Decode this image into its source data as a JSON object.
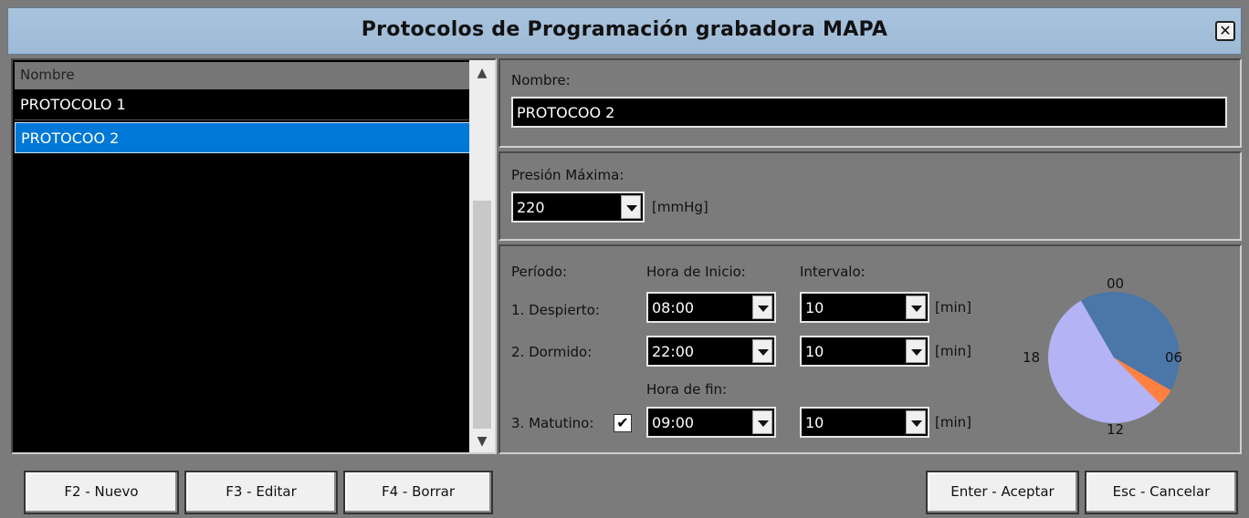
{
  "window": {
    "title": "Protocolos de Programación grabadora MAPA",
    "close_label": "✕"
  },
  "list": {
    "header": "Nombre",
    "rows": [
      "PROTOCOLO 1",
      "PROTOCOO 2"
    ],
    "selected_index": 1
  },
  "nombre": {
    "label": "Nombre:",
    "value": "PROTOCOO 2"
  },
  "presion": {
    "label": "Presión Máxima:",
    "value": "220",
    "unit": "[mmHg]"
  },
  "periodo": {
    "col_period": "Período:",
    "col_start": "Hora de Inicio:",
    "col_interval": "Intervalo:",
    "col_end": "Hora de fin:",
    "unit": "[min]",
    "rows": [
      {
        "label": "1. Despierto:",
        "time": "08:00",
        "interval": "10"
      },
      {
        "label": "2. Dormido:",
        "time": "22:00",
        "interval": "10"
      },
      {
        "label": "3. Matutino:",
        "time": "09:00",
        "interval": "10",
        "checked": true
      }
    ]
  },
  "clock": {
    "labels": {
      "top": "00",
      "right": "06",
      "bottom": "12",
      "left": "18"
    },
    "segments": [
      {
        "name": "Despierto",
        "from_hour": 8,
        "to_hour": 22,
        "color": "#b3b3f5"
      },
      {
        "name": "Dormido",
        "from_hour": 22,
        "to_hour": 8,
        "color": "#4a76a8"
      },
      {
        "name": "Matutino",
        "from_hour": 8,
        "to_hour": 9,
        "color": "#ff8040"
      }
    ]
  },
  "buttons": {
    "new": "F2 - Nuevo",
    "edit": "F3 - Editar",
    "delete": "F4 - Borrar",
    "accept": "Enter - Aceptar",
    "cancel": "Esc - Cancelar"
  }
}
